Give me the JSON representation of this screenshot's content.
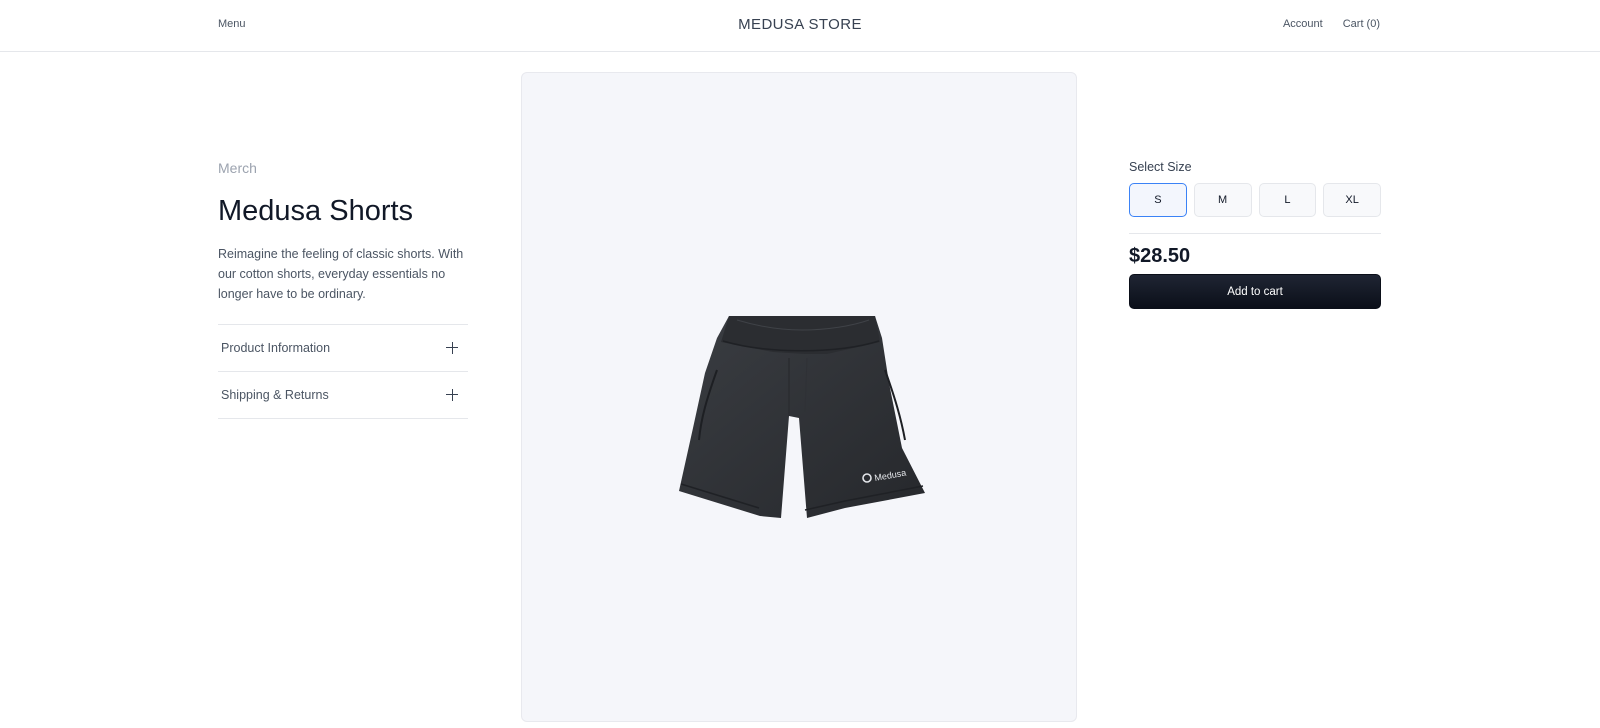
{
  "header": {
    "menu_label": "Menu",
    "store_name": "MEDUSA STORE",
    "account_label": "Account",
    "cart_label": "Cart (0)"
  },
  "product": {
    "collection": "Merch",
    "title": "Medusa Shorts",
    "description": "Reimagine the feeling of classic shorts. With our cotton shorts, everyday essentials no longer have to be ordinary.",
    "accordion": [
      {
        "label": "Product Information",
        "icon": "plus-icon"
      },
      {
        "label": "Shipping & Returns",
        "icon": "plus-icon"
      }
    ],
    "image": {
      "logo_text": "Medusa",
      "color": "#2f3237"
    }
  },
  "purchase": {
    "size_label": "Select Size",
    "sizes": [
      "S",
      "M",
      "L",
      "XL"
    ],
    "selected_size": "S",
    "price": "$28.50",
    "add_to_cart_label": "Add to cart"
  },
  "colors": {
    "accent": "#3b82f6",
    "button_dark": "#0b0f19",
    "image_bg": "#f5f6fa"
  }
}
